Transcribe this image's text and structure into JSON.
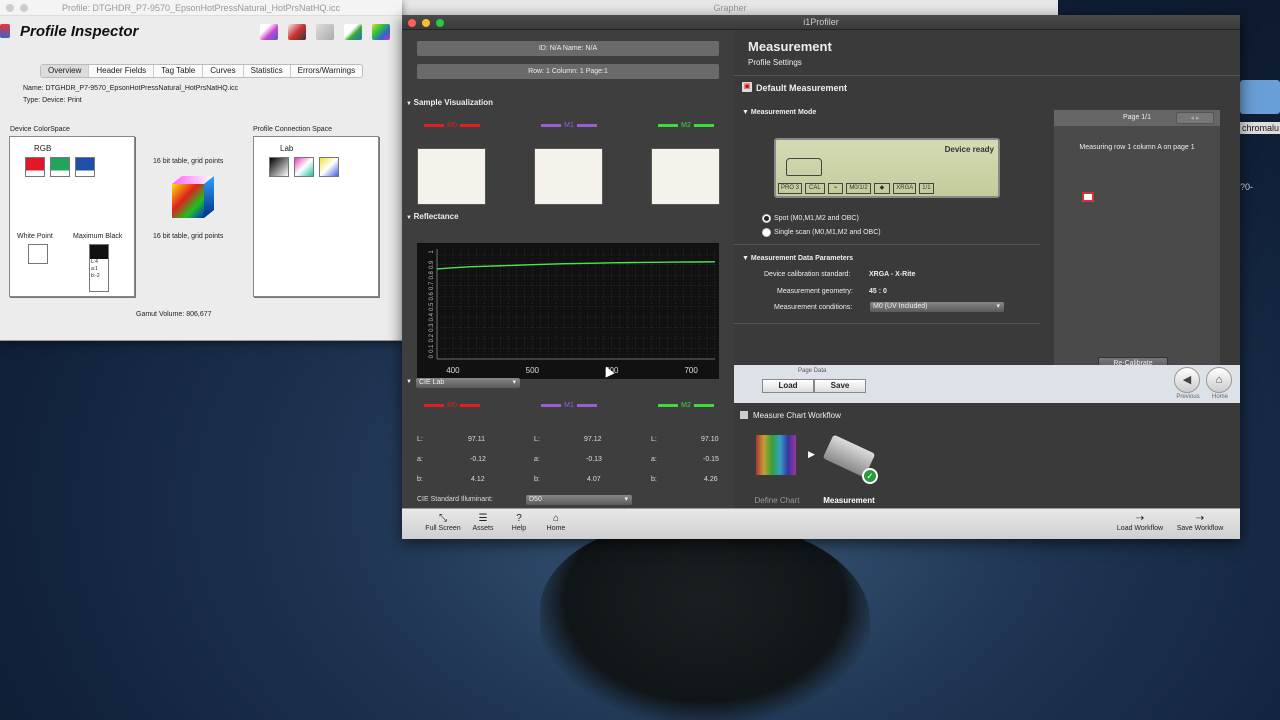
{
  "desktop": {
    "grapher_title": "Grapher",
    "side_label": "chromalu",
    "side_sub": "?0-"
  },
  "pi": {
    "window_title": "Profile: DTGHDR_P7-9570_EpsonHotPressNatural_HotPrsNatHQ.icc",
    "app_title": "Profile Inspector",
    "tabs": [
      "Overview",
      "Header Fields",
      "Tag Table",
      "Curves",
      "Statistics",
      "Errors/Warnings"
    ],
    "name_line": "Name:  DTGHDR_P7-9570_EpsonHotPressNatural_HotPrsNatHQ.icc",
    "type_line": "Type:  Device: Print",
    "device_cs_label": "Device ColorSpace",
    "pcs_label": "Profile Connection Space",
    "rgb_label": "RGB",
    "lab_label": "Lab",
    "table_top": "16 bit table,  grid points",
    "table_bottom": "16 bit table,  grid points",
    "white_point": "White Point",
    "max_black": "Maximum Black",
    "black_l": "L:4",
    "black_a": "a:1",
    "black_b": "b:-2",
    "gamut": "Gamut Volume:  806,677",
    "colors": {
      "red": "#e0182a",
      "green": "#22a45a",
      "blue": "#1f4fa8"
    }
  },
  "i1": {
    "window_title": "i1Profiler",
    "id_bar": "ID: N/A    Name: N/A",
    "row_bar": "Row: 1   Column: 1   Page:1",
    "sample_vis": "Sample Visualization",
    "reflectance": "Reflectance",
    "m0": "M0",
    "m1": "M1",
    "m2": "M2",
    "y_ticks": [
      "1",
      "0.9",
      "0.8",
      "0.7",
      "0.6",
      "0.5",
      "0.4",
      "0.3",
      "0.2",
      "0.1",
      "0"
    ],
    "x_ticks": [
      "400",
      "500",
      "600",
      "700"
    ],
    "cie_dropdown": "CIE Lab",
    "L": "L:",
    "a": "a:",
    "b": "b:",
    "m0_vals": [
      "97.11",
      "-0.12",
      "4.12"
    ],
    "m1_vals": [
      "97.12",
      "-0.13",
      "4.07"
    ],
    "m2_vals": [
      "97.10",
      "-0.15",
      "4.26"
    ],
    "illum_label": "CIE Standard Illuminant:",
    "illum_value": "D50",
    "measurement_title": "Measurement",
    "profile_settings": "Profile Settings",
    "default_measurement": "Default Measurement",
    "measurement_mode": "Measurement Mode",
    "device_ready": "Device ready",
    "lcd_items": [
      "PRO 3",
      "CAL",
      "M0/1/2",
      "XRGA",
      "1/1"
    ],
    "spot": "Spot (M0,M1,M2 and OBC)",
    "single_scan": "Single scan (M0,M1,M2 and OBC)",
    "mdp": "Measurement Data Parameters",
    "dcs_label": "Device calibration standard:",
    "dcs_value": "XRGA - X-Rite",
    "geom_label": "Measurement geometry:",
    "geom_value": "45 : 0",
    "cond_label": "Measurement conditions:",
    "cond_value": "M0 (UV Included)",
    "page_label": "Page 1/1",
    "measuring_text": "Measuring row 1 column A on page 1",
    "recalibrate": "Re-Calibrate",
    "page_data": "Page Data",
    "load": "Load",
    "save": "Save",
    "previous": "Previous",
    "home": "Home",
    "mcw": "Measure Chart Workflow",
    "define_chart": "Define Chart",
    "measurement_step": "Measurement",
    "toolbar": [
      "Full Screen",
      "Assets",
      "Help",
      "Home"
    ],
    "load_workflow": "Load Workflow",
    "save_workflow": "Save Workflow",
    "colors": {
      "m0": "#e02020",
      "m1": "#9a5fd0",
      "m2": "#3ddc3d",
      "curve": "#52e052"
    }
  },
  "chart_data": {
    "type": "line",
    "title": "",
    "xlabel": "",
    "ylabel": "",
    "xlim": [
      380,
      730
    ],
    "ylim": [
      0,
      1.05
    ],
    "series": [
      {
        "x": [
          380,
          400,
          420,
          440,
          460,
          480,
          500,
          520,
          540,
          560,
          580,
          600,
          620,
          640,
          660,
          680,
          700,
          720,
          730
        ],
        "y": [
          0.86,
          0.87,
          0.88,
          0.885,
          0.89,
          0.895,
          0.9,
          0.905,
          0.91,
          0.912,
          0.915,
          0.918,
          0.92,
          0.922,
          0.923,
          0.925,
          0.926,
          0.927,
          0.928
        ]
      }
    ]
  }
}
